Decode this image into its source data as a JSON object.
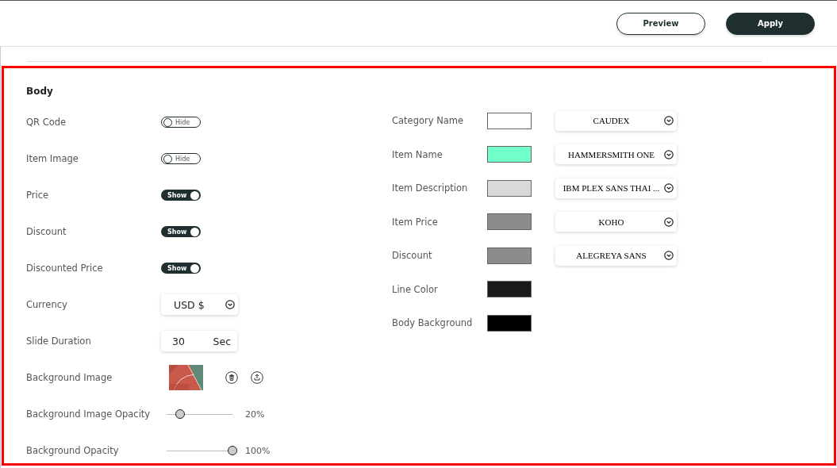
{
  "toolbar": {
    "buttons": [
      {
        "label": "Preview",
        "kind": "outline"
      },
      {
        "label": "Apply",
        "kind": "filled"
      }
    ]
  },
  "section": {
    "title": "Body",
    "left_rows": [
      {
        "label": "QR Code",
        "kind": "toggle",
        "on": false,
        "state_text": "Hide"
      },
      {
        "label": "Item Image",
        "kind": "toggle",
        "on": false,
        "state_text": "Hide"
      },
      {
        "label": "Price",
        "kind": "toggle",
        "on": true,
        "state_text": "Show"
      },
      {
        "label": "Discount",
        "kind": "toggle",
        "on": true,
        "state_text": "Show"
      },
      {
        "label": "Discounted Price",
        "kind": "toggle",
        "on": true,
        "state_text": "Show"
      },
      {
        "label": "Currency",
        "kind": "select",
        "value": "USD $"
      },
      {
        "label": "Slide Duration",
        "kind": "number",
        "value": "30",
        "unit": "Sec"
      },
      {
        "label": "Background Image"
      },
      {
        "label": "Background Image Opacity",
        "kind": "slider",
        "level": 0.2,
        "reading": "20%"
      },
      {
        "label": "Background Opacity",
        "kind": "slider",
        "level": 1.0,
        "reading": "100%"
      }
    ],
    "right_rows": [
      {
        "label": "Category Name",
        "color": "#ffffff",
        "font": "CAUDEX"
      },
      {
        "label": "Item Name",
        "color": "#73ffc9",
        "font": "HAMMERSMITH ONE"
      },
      {
        "label": "Item Description",
        "color": "#d9d9d9",
        "font": "IBM PLEX SANS THAI ..."
      },
      {
        "label": "Item Price",
        "color": "#8c8c8c",
        "font": "KOHO"
      },
      {
        "label": "Discount",
        "color": "#8c8c8c",
        "font": "ALEGREYA SANS"
      },
      {
        "label": "Line Color",
        "color": "#1a1a1a"
      },
      {
        "label": "Body Background",
        "color": "#000000"
      }
    ]
  }
}
